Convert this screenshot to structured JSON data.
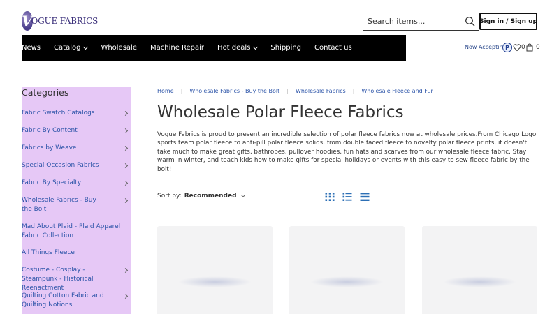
{
  "brand": {
    "logo_text": "OGUE FABRICS",
    "logo_initial": "V"
  },
  "search": {
    "placeholder": "Search items..."
  },
  "auth": {
    "signin_label": "Sign in / Sign up"
  },
  "nav": {
    "items": [
      {
        "label": "News",
        "has_dropdown": false
      },
      {
        "label": "Catalog",
        "has_dropdown": true
      },
      {
        "label": "Wholesale",
        "has_dropdown": false
      },
      {
        "label": "Machine Repair",
        "has_dropdown": false
      },
      {
        "label": "Hot deals",
        "has_dropdown": true
      },
      {
        "label": "Shipping",
        "has_dropdown": false
      },
      {
        "label": "Contact us",
        "has_dropdown": false
      }
    ]
  },
  "header_right": {
    "accepting_label": "Now Accepting",
    "paypal_letter": "P",
    "wishlist_count": "0",
    "cart_count": "0"
  },
  "sidebar": {
    "title": "Categories",
    "items": [
      {
        "label": "Fabric Swatch Catalogs",
        "has_children": true
      },
      {
        "label": "Fabric By Content",
        "has_children": true
      },
      {
        "label": "Fabrics by Weave",
        "has_children": true
      },
      {
        "label": "Special Occasion Fabrics",
        "has_children": true
      },
      {
        "label": "Fabric By Specialty",
        "has_children": true
      },
      {
        "label": "Wholesale Fabrics - Buy the Bolt",
        "has_children": true
      },
      {
        "label": "Mad About Plaid - Plaid Apparel Fabric Collection",
        "has_children": false
      },
      {
        "label": "All Things Fleece",
        "has_children": false
      },
      {
        "label": "Costume - Cosplay - Steampunk - Historical Reenactment",
        "has_children": true
      },
      {
        "label": "Quilting Cotton Fabric and Quilting Notions",
        "has_children": true
      }
    ]
  },
  "breadcrumb": [
    "Home",
    "Wholesale Fabrics - Buy the Bolt",
    "Wholesale Fabrics",
    "Wholesale Fleece and Fur"
  ],
  "page": {
    "title": "Wholesale Polar Fleece Fabrics",
    "description": "Vogue Fabrics is proud to present an incredible selection of polar fleece fabrics now at wholesale prices.From Chicago Logo sports team polar fleece to anti-pill polar fleece solids, from double faced fleece to novelty polar fleece prints, it doesn't take much to make great gifts, bathrobes, pullover hoodies, fun hats and scarves from our wholesale fleece fabric. Stay warm in winter, and teach kids how to make gifts for special holidays or events with this easy to sew fleece fabric by the bolt!"
  },
  "sort": {
    "label": "Sort by:",
    "value": "Recommended"
  },
  "views": [
    "grid-view-icon",
    "list-view-icon",
    "compact-list-view-icon"
  ],
  "colors": {
    "nav_bg": "#000000",
    "sidebar_bg": "#e6c8f6",
    "link": "#2c54a8",
    "view_icon": "#2c6fb5"
  }
}
